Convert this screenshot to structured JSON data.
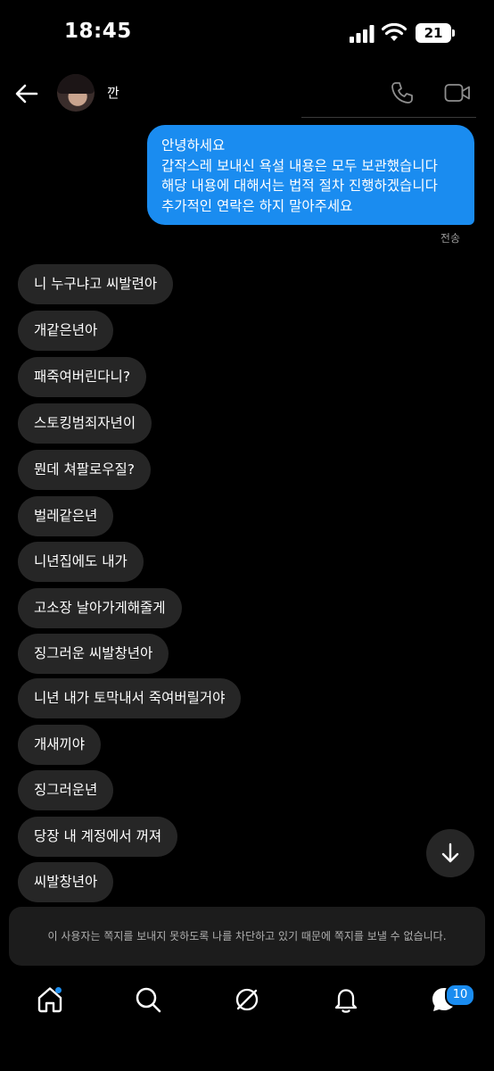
{
  "status_bar": {
    "time": "18:45",
    "battery": "21"
  },
  "header": {
    "username": "깐"
  },
  "outgoing": {
    "lines": [
      "안녕하세요",
      "갑작스레 보내신 욕설 내용은 모두 보관했습니다",
      "해당 내용에 대해서는 법적 절차 진행하겠습니다",
      "추가적인 연락은 하지 말아주세요"
    ],
    "status": "전송"
  },
  "incoming": [
    "니 누구냐고 씨발련아",
    "개같은년아",
    "패죽여버린다니?",
    "스토킹범죄자년이",
    "뭔데 쳐팔로우질?",
    "벌레같은년",
    "니년집에도 내가",
    "고소장 날아가게해줄게",
    "징그러운 씨발창년아",
    "니년 내가 토막내서 죽여버릴거야",
    "개새끼야",
    "징그러운년",
    "당장 내 계정에서 꺼져",
    "씨발창년아"
  ],
  "blocked_notice": "이 사용자는 쪽지를 보내지 못하도록 나를 차단하고 있기 때문에 쪽지를 보낼 수 없습니다.",
  "tabbar": {
    "messages_badge": "10"
  },
  "colors": {
    "accent": "#1a8cf0",
    "bubble_incoming": "#262626",
    "background": "#000000"
  }
}
